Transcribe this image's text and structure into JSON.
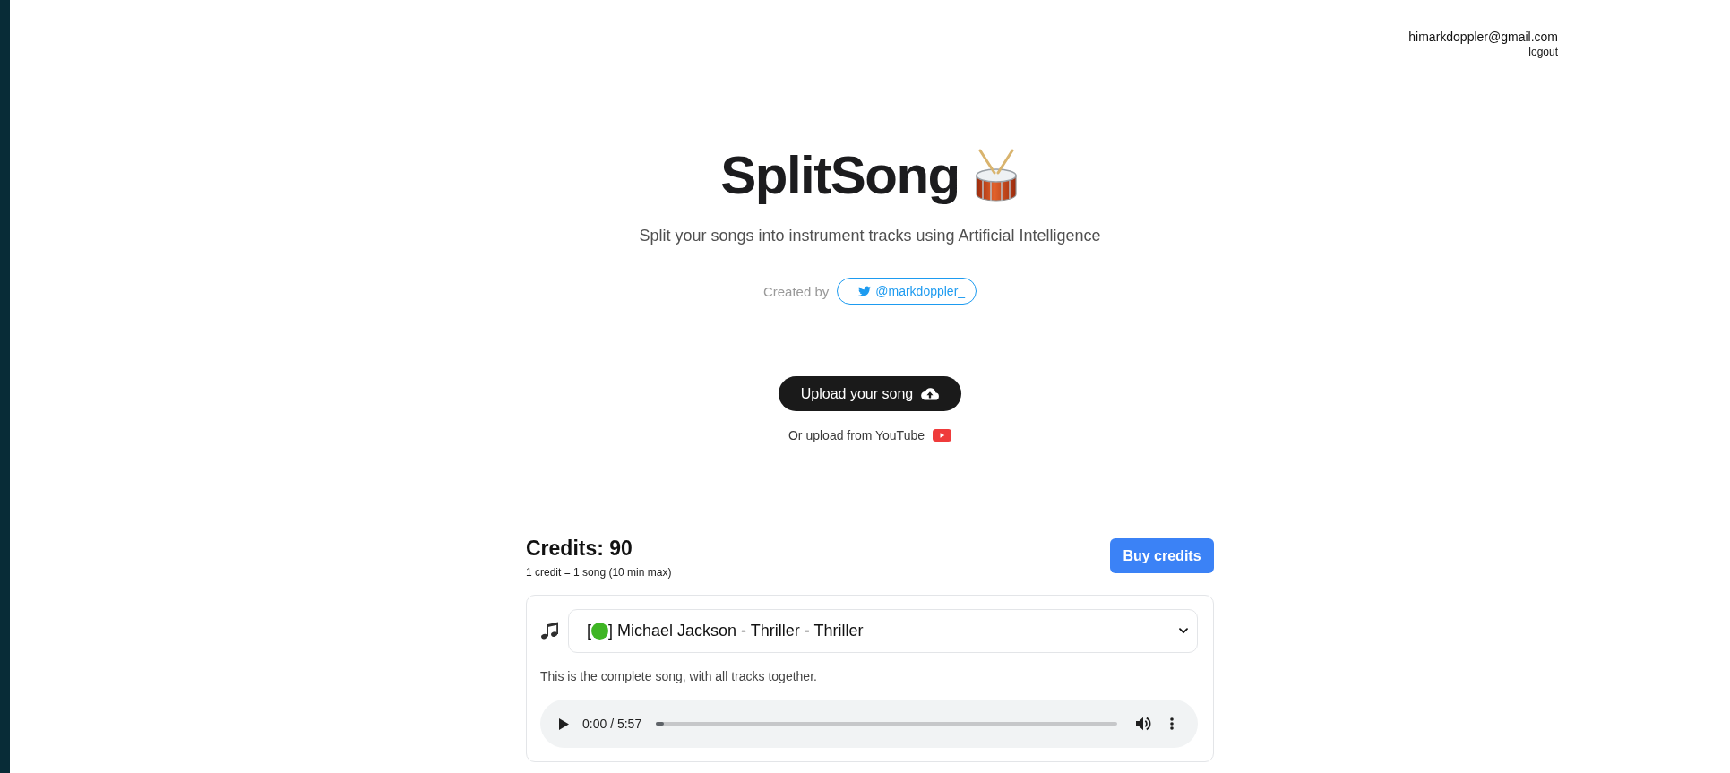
{
  "account": {
    "email": "himarkdoppler@gmail.com",
    "logout": "logout"
  },
  "hero": {
    "title": "SplitSong",
    "subtitle": "Split your songs into instrument tracks using Artificial Intelligence",
    "credit_label": "Created by",
    "twitter_handle": "@markdoppler_"
  },
  "upload": {
    "button": "Upload your song",
    "youtube_link": "Or upload from YouTube"
  },
  "credits": {
    "heading": "Credits: 90",
    "note": "1 credit = 1 song (10 min max)",
    "buy_button": "Buy credits"
  },
  "song": {
    "select_parts": [
      {
        "kind": "text",
        "text": "["
      },
      {
        "kind": "status_dot",
        "color": "#3fb524"
      },
      {
        "kind": "text",
        "text": "] Michael Jackson - Thriller - Thriller"
      }
    ],
    "description": "This is the complete song, with all tracks together.",
    "player": {
      "time": "0:00 / 5:57",
      "level": 0
    }
  }
}
